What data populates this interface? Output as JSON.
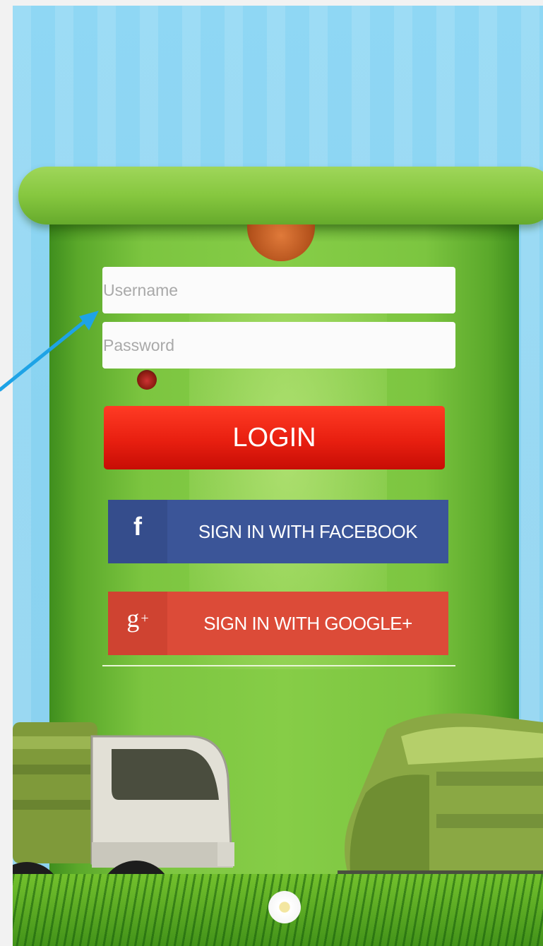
{
  "form": {
    "username_placeholder": "Username",
    "password_placeholder": "Password",
    "login_label": "LOGIN"
  },
  "social": {
    "facebook": {
      "icon_glyph": "f",
      "label": "SIGN IN WITH FACEBOOK"
    },
    "google": {
      "icon_glyph": "g",
      "icon_plus": "+",
      "label": "SIGN IN WITH GOOGLE+"
    }
  },
  "colors": {
    "login_red": "#e81f10",
    "facebook_blue": "#3b5598",
    "google_red": "#dc4b38",
    "bin_green": "#7cc540",
    "sky_blue": "#8fd7f4",
    "annotation_arrow": "#1ea3e6"
  }
}
